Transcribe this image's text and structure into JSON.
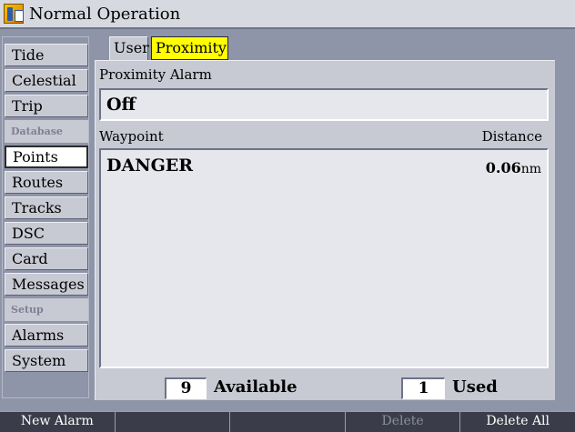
{
  "window": {
    "title": "Normal Operation",
    "icon": "app-icon"
  },
  "sidebar": {
    "items": [
      {
        "label": "Tide",
        "type": "item"
      },
      {
        "label": "Celestial",
        "type": "item"
      },
      {
        "label": "Trip",
        "type": "item"
      },
      {
        "label": "Database",
        "type": "header"
      },
      {
        "label": "Points",
        "type": "item",
        "selected": true
      },
      {
        "label": "Routes",
        "type": "item"
      },
      {
        "label": "Tracks",
        "type": "item"
      },
      {
        "label": "DSC",
        "type": "item"
      },
      {
        "label": "Card",
        "type": "item"
      },
      {
        "label": "Messages",
        "type": "item"
      },
      {
        "label": "Setup",
        "type": "header"
      },
      {
        "label": "Alarms",
        "type": "item"
      },
      {
        "label": "System",
        "type": "item"
      }
    ]
  },
  "tabs": [
    {
      "label": "User",
      "active": false
    },
    {
      "label": "Proximity",
      "active": true
    }
  ],
  "proximity": {
    "alarm_label": "Proximity Alarm",
    "alarm_value": "Off",
    "col_waypoint": "Waypoint",
    "col_distance": "Distance",
    "rows": [
      {
        "waypoint": "DANGER",
        "distance": "0.06",
        "unit": "nm"
      }
    ],
    "available_count": "9",
    "available_label": "Available",
    "used_count": "1",
    "used_label": "Used"
  },
  "softkeys": [
    {
      "label": "New Alarm",
      "enabled": true
    },
    {
      "label": "",
      "enabled": true
    },
    {
      "label": "",
      "enabled": true
    },
    {
      "label": "Delete",
      "enabled": false
    },
    {
      "label": "Delete All",
      "enabled": true
    }
  ],
  "colors": {
    "accent_tab": "#ffff00",
    "background": "#8f95a8",
    "panel": "#c7c9d3"
  }
}
